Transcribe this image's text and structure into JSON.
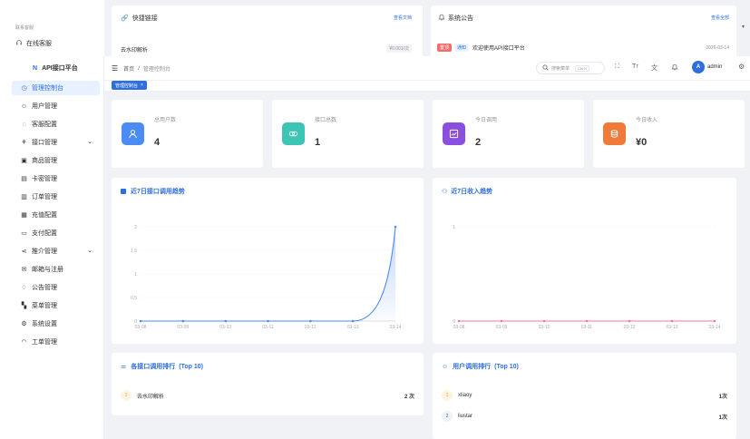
{
  "top": {
    "contact_label": "联系客服",
    "online_service": "在线客服",
    "quick_links": {
      "title": "快捷链接",
      "view_docs": "查看文档",
      "item_name": "去水印解析",
      "item_price": "¥0.001/次"
    },
    "announcement": {
      "title": "系统公告",
      "view_all": "查看全部",
      "badge_top": "置顶",
      "badge_notice": "通知",
      "text": "欢迎使用API接口平台",
      "date": "2026-03-14"
    }
  },
  "sidebar": {
    "logo_text": "API接口平台",
    "items": [
      {
        "label": "管理控制台",
        "icon": "dashboard-icon",
        "active": true
      },
      {
        "label": "用户管理",
        "icon": "user-icon"
      },
      {
        "label": "客服配置",
        "icon": "chat-icon"
      },
      {
        "label": "接口管理",
        "icon": "api-icon",
        "expandable": true
      },
      {
        "label": "商品管理",
        "icon": "shop-icon"
      },
      {
        "label": "卡密管理",
        "icon": "card-icon"
      },
      {
        "label": "订单管理",
        "icon": "order-icon"
      },
      {
        "label": "充值配置",
        "icon": "recharge-icon"
      },
      {
        "label": "支付配置",
        "icon": "payment-icon"
      },
      {
        "label": "推介管理",
        "icon": "share-icon",
        "expandable": true
      },
      {
        "label": "邮箱与注册",
        "icon": "mail-icon"
      },
      {
        "label": "公告管理",
        "icon": "bell-icon"
      },
      {
        "label": "菜单管理",
        "icon": "menu-icon"
      },
      {
        "label": "系统设置",
        "icon": "gear-icon"
      },
      {
        "label": "工单管理",
        "icon": "headset-icon"
      }
    ]
  },
  "header": {
    "breadcrumb_home": "首页",
    "breadcrumb_sep": "/",
    "breadcrumb_current": "管理控制台",
    "search_placeholder": "搜索菜单",
    "search_shortcut": "Ctrl K",
    "username": "admin",
    "avatar_letter": "A"
  },
  "tags": {
    "active_tag": "管理控制台"
  },
  "stats": [
    {
      "label": "总用户数",
      "value": "4",
      "color": "#4b8bf4"
    },
    {
      "label": "接口总数",
      "value": "1",
      "color": "#3cc4b4"
    },
    {
      "label": "今日调用",
      "value": "2",
      "color": "#8b4fe0"
    },
    {
      "label": "今日收入",
      "value": "¥0",
      "color": "#f07a3a"
    }
  ],
  "charts": {
    "calls_title": "近7日接口调用趋势",
    "income_title": "近7日收入趋势"
  },
  "chart_data": [
    {
      "type": "area",
      "x": [
        "03-08",
        "03-09",
        "03-10",
        "03-11",
        "03-12",
        "03-13",
        "03-14"
      ],
      "values": [
        0,
        0,
        0,
        0,
        0,
        0,
        2
      ],
      "ylim": [
        0,
        2
      ],
      "yticks": [
        "0",
        "0.5",
        "1",
        "1.5",
        "2"
      ],
      "color": "#4b8bf4"
    },
    {
      "type": "line",
      "x": [
        "03-08",
        "03-09",
        "03-10",
        "03-11",
        "03-12",
        "03-13",
        "03-14"
      ],
      "values": [
        0,
        0,
        0,
        0,
        0,
        0,
        0
      ],
      "ylim": [
        0,
        1
      ],
      "yticks": [
        "0",
        "1"
      ],
      "color": "#f0789a"
    }
  ],
  "rankings": {
    "api_title": "各接口调用排行",
    "api_suffix": "(Top 10)",
    "api_items": [
      {
        "rank": "1",
        "name": "去水印解析",
        "count": "2 次"
      }
    ],
    "user_title": "用户调用排行",
    "user_suffix": "(Top 10)",
    "user_items": [
      {
        "rank": "1",
        "name": "xliaoy",
        "count": "1次"
      },
      {
        "rank": "2",
        "name": "liustar",
        "count": "1次"
      }
    ]
  }
}
